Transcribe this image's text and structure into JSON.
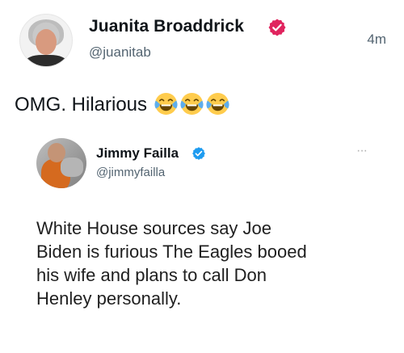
{
  "tweet": {
    "author_name": "Juanita Broaddrick",
    "handle": "@juanitab",
    "time": "4m",
    "text": "OMG. Hilarious",
    "emojis": [
      "face-with-tears-of-joy",
      "face-with-tears-of-joy",
      "face-with-tears-of-joy"
    ]
  },
  "quoted_tweet": {
    "author_name": "Jimmy Failla",
    "handle": "@jimmyfailla",
    "more_label": "···",
    "text": "White House sources say Joe\nBiden is furious The Eagles booed\nhis wife and plans to call Don\nHenley personally."
  },
  "colors": {
    "verified_badge": "#e0245e",
    "verified_blue": "#1d9bf0",
    "secondary_text": "#536471"
  }
}
